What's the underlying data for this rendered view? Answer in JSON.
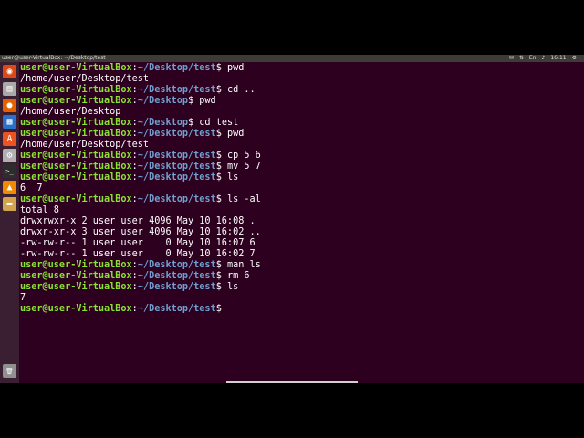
{
  "window": {
    "title": "user@user-VirtualBox: ~/Desktop/test",
    "time": "16:11",
    "indicators": [
      "mail-icon",
      "network-icon",
      "keyboard-icon",
      "volume-icon"
    ]
  },
  "launcher": {
    "items": [
      {
        "name": "dash-icon",
        "color": "#dd4814",
        "glyph": "◉"
      },
      {
        "name": "files-icon",
        "color": "#a9a9a9",
        "glyph": "▤"
      },
      {
        "name": "firefox-icon",
        "color": "#e66000",
        "glyph": "●"
      },
      {
        "name": "writer-icon",
        "color": "#2a6fc9",
        "glyph": "▦"
      },
      {
        "name": "appstore-icon",
        "color": "#e95420",
        "glyph": "A"
      },
      {
        "name": "settings-icon",
        "color": "#b0b0b0",
        "glyph": "⚙"
      },
      {
        "name": "terminal-icon",
        "color": "#2d2d2d",
        "glyph": ">_"
      },
      {
        "name": "vlc-icon",
        "color": "#f08a00",
        "glyph": "▲"
      },
      {
        "name": "folder-icon",
        "color": "#d2a450",
        "glyph": "▬"
      },
      {
        "name": "trash-icon",
        "color": "#909090",
        "glyph": "🗑"
      }
    ]
  },
  "terminal": {
    "prompt_user": "user@user-VirtualBox",
    "prompt_sep": ":",
    "lines": [
      {
        "type": "prompt",
        "path": "~/Desktop/test",
        "cmd": " pwd"
      },
      {
        "type": "out",
        "text": "/home/user/Desktop/test"
      },
      {
        "type": "prompt",
        "path": "~/Desktop/test",
        "cmd": " cd .."
      },
      {
        "type": "prompt",
        "path": "~/Desktop",
        "cmd": " pwd"
      },
      {
        "type": "out",
        "text": "/home/user/Desktop"
      },
      {
        "type": "prompt",
        "path": "~/Desktop",
        "cmd": " cd test"
      },
      {
        "type": "prompt",
        "path": "~/Desktop/test",
        "cmd": " pwd"
      },
      {
        "type": "out",
        "text": "/home/user/Desktop/test"
      },
      {
        "type": "prompt",
        "path": "~/Desktop/test",
        "cmd": " cp 5 6"
      },
      {
        "type": "prompt",
        "path": "~/Desktop/test",
        "cmd": " mv 5 7"
      },
      {
        "type": "prompt",
        "path": "~/Desktop/test",
        "cmd": " ls"
      },
      {
        "type": "out",
        "text": "6  7"
      },
      {
        "type": "prompt",
        "path": "~/Desktop/test",
        "cmd": " ls -al"
      },
      {
        "type": "out",
        "text": "total 8"
      },
      {
        "type": "out",
        "text": "drwxrwxr-x 2 user user 4096 May 10 16:08 ."
      },
      {
        "type": "out",
        "text": "drwxr-xr-x 3 user user 4096 May 10 16:02 .."
      },
      {
        "type": "out",
        "text": "-rw-rw-r-- 1 user user    0 May 10 16:07 6"
      },
      {
        "type": "out",
        "text": "-rw-rw-r-- 1 user user    0 May 10 16:02 7"
      },
      {
        "type": "prompt",
        "path": "~/Desktop/test",
        "cmd": " man ls"
      },
      {
        "type": "prompt",
        "path": "~/Desktop/test",
        "cmd": " rm 6"
      },
      {
        "type": "prompt",
        "path": "~/Desktop/test",
        "cmd": " ls"
      },
      {
        "type": "out",
        "text": "7"
      },
      {
        "type": "prompt",
        "path": "~/Desktop/test",
        "cmd": ""
      }
    ]
  },
  "colors": {
    "terminal_bg": "#2c001e",
    "user": "#8ae234",
    "path": "#729fcf",
    "launcher_bg": "#3a1e31",
    "panel_bg": "#3c3b37"
  }
}
